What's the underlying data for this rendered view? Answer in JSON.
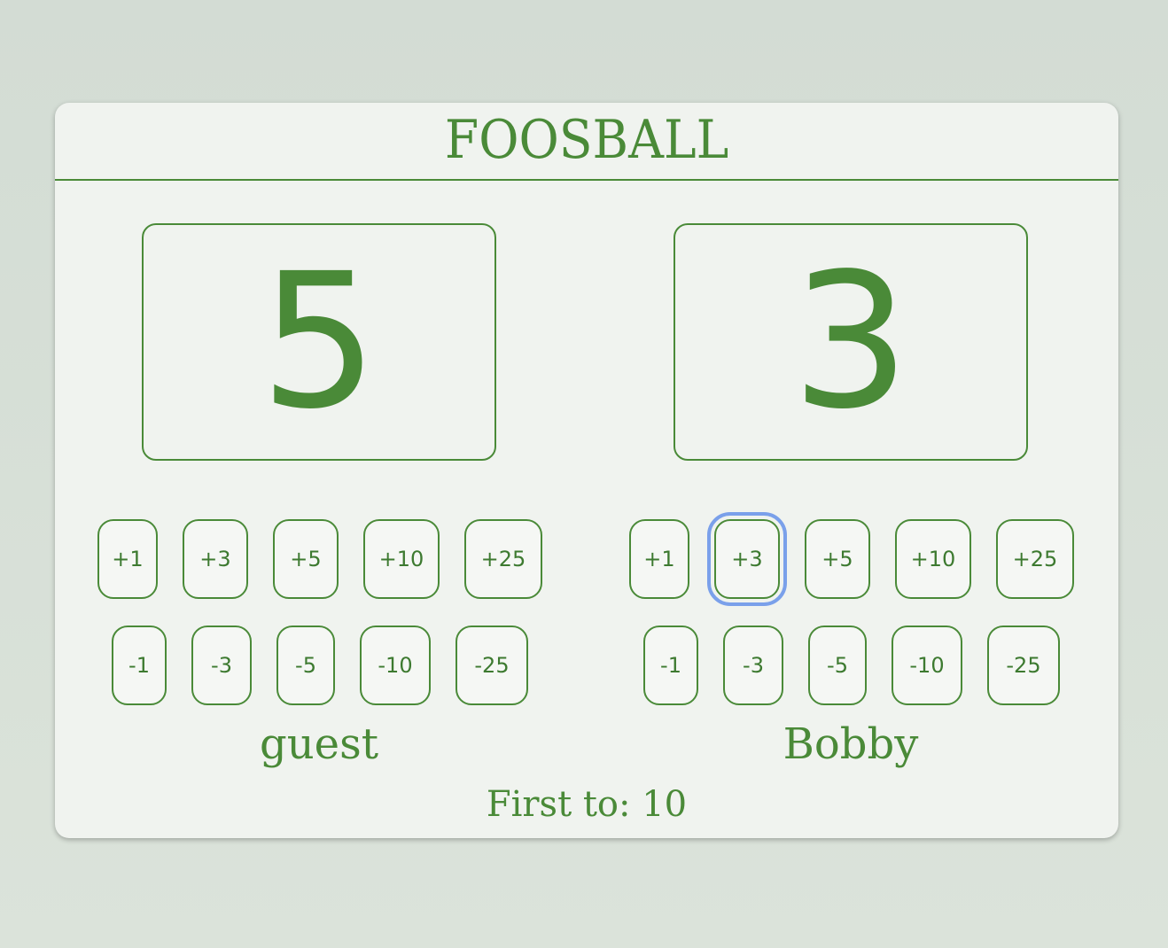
{
  "app": {
    "title": "FOOSBALL",
    "first_to_label": "First to: 10"
  },
  "players": [
    {
      "name": "guest",
      "score": "5",
      "increment_buttons": [
        "+1",
        "+3",
        "+5",
        "+10",
        "+25"
      ],
      "decrement_buttons": [
        "-1",
        "-3",
        "-5",
        "-10",
        "-25"
      ]
    },
    {
      "name": "Bobby",
      "score": "3",
      "increment_buttons": [
        "+1",
        "+3",
        "+5",
        "+10",
        "+25"
      ],
      "decrement_buttons": [
        "-1",
        "-3",
        "-5",
        "-10",
        "-25"
      ]
    }
  ],
  "colors": {
    "accent": "#4a8a38",
    "card_background": "#f0f3ef",
    "page_background": "#d8e0d8",
    "focus_ring": "#7aa0ea"
  },
  "focused_button": "Bobby +3"
}
